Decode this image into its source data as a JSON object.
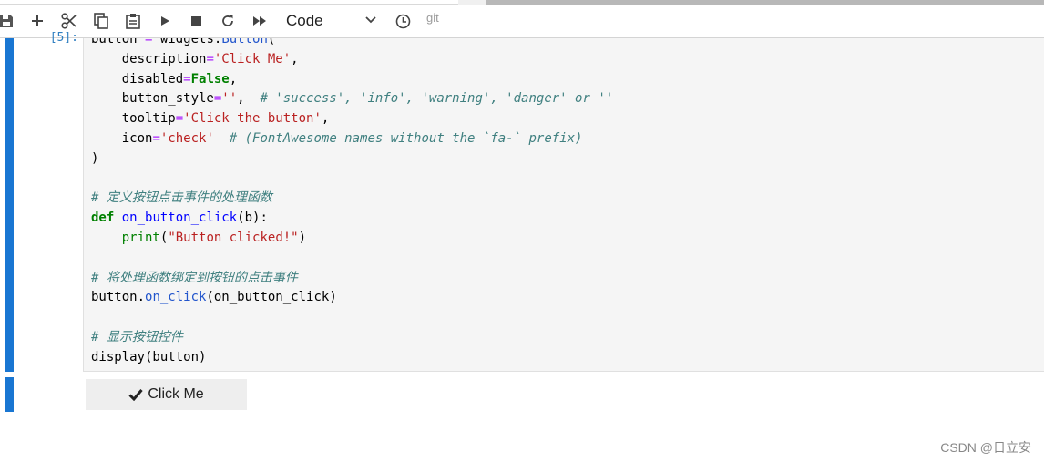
{
  "toolbar": {
    "buttons": [
      {
        "name": "save-icon"
      },
      {
        "name": "add-cell-icon"
      },
      {
        "name": "cut-icon"
      },
      {
        "name": "copy-icon"
      },
      {
        "name": "paste-icon"
      },
      {
        "name": "run-icon"
      },
      {
        "name": "stop-icon"
      },
      {
        "name": "restart-icon"
      },
      {
        "name": "run-all-icon"
      }
    ],
    "cell_type": "Code",
    "history_icon": "clock-icon",
    "git_label": "git"
  },
  "cell": {
    "prompt": "[5]:",
    "code_lines": [
      "button = widgets.Button(",
      "    description='Click Me',",
      "    disabled=False,",
      "    button_style='',  # 'success', 'info', 'warning', 'danger' or ''",
      "    tooltip='Click the button',",
      "    icon='check'  # (FontAwesome names without the `fa-` prefix)",
      ")",
      "",
      "# 定义按钮点击事件的处理函数",
      "def on_button_click(b):",
      "    print(\"Button clicked!\")",
      "",
      "# 将处理函数绑定到按钮的点击事件",
      "button.on_click(on_button_click)",
      "",
      "# 显示按钮控件",
      "display(button)"
    ]
  },
  "output": {
    "button_label": "Click Me",
    "button_icon": "check-icon"
  },
  "watermark": "CSDN @日立安",
  "colors": {
    "cell_bar": "#1976d2",
    "string": "#ba2121",
    "keyword": "#008000",
    "comment": "#408080"
  }
}
